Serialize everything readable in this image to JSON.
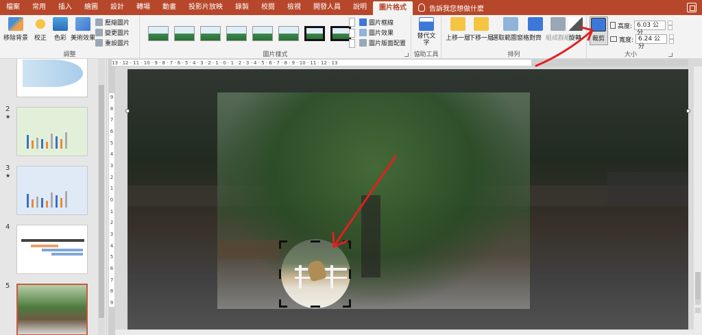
{
  "tabs": [
    {
      "label": "檔案",
      "active": false
    },
    {
      "label": "常用",
      "active": false
    },
    {
      "label": "插入",
      "active": false
    },
    {
      "label": "繪圖",
      "active": false
    },
    {
      "label": "設計",
      "active": false
    },
    {
      "label": "轉場",
      "active": false
    },
    {
      "label": "動畫",
      "active": false
    },
    {
      "label": "投影片放映",
      "active": false
    },
    {
      "label": "錄製",
      "active": false
    },
    {
      "label": "校閱",
      "active": false
    },
    {
      "label": "檢視",
      "active": false
    },
    {
      "label": "開發人員",
      "active": false
    },
    {
      "label": "說明",
      "active": false
    },
    {
      "label": "圖片格式",
      "active": true
    }
  ],
  "tell_me": "告訴我您想做什麼",
  "ribbon": {
    "adjust": {
      "label": "調整",
      "remove_bg": "移除背景",
      "corrections": "校正",
      "color": "色彩",
      "artistic": "美術效果",
      "compress": "壓縮圖片",
      "change": "變更圖片",
      "reset": "重設圖片"
    },
    "styles": {
      "label": "圖片樣式",
      "border": "圖片框線",
      "effects": "圖片效果",
      "layout": "圖片版面配置"
    },
    "accessibility": {
      "label": "協助工具",
      "alt_text": "替代文字"
    },
    "arrange": {
      "label": "排列",
      "bring_forward": "上移一層",
      "send_backward": "下移一層",
      "selection_pane": "選取範圍窗格",
      "align": "對齊",
      "group": "組成群組",
      "rotate": "旋轉"
    },
    "size": {
      "label": "大小",
      "crop": "裁剪",
      "height_label": "高度:",
      "height_value": "6.03 公分",
      "width_label": "寬度:",
      "width_value": "6.24 公分"
    }
  },
  "slides": [
    {
      "number": "",
      "starred": false
    },
    {
      "number": "2",
      "starred": true
    },
    {
      "number": "3",
      "starred": true
    },
    {
      "number": "4",
      "starred": false
    },
    {
      "number": "5",
      "starred": false,
      "selected": true
    }
  ],
  "ruler": {
    "horizontal": "13 · 12 · 11 · 10 · 9 · 8 · 7 · 6 · 5 · 4 · 3 · 2 · 1 · 0 · 1 · 2 · 3 · 4 · 5 · 6 · 7 · 8 · 9 · 10 · 11 · 12 · 13",
    "vertical": [
      "9",
      "8",
      "7",
      "6",
      "5",
      "4",
      "3",
      "2",
      "1",
      "0",
      "1",
      "2",
      "3",
      "4",
      "5",
      "6",
      "7",
      "8",
      "9"
    ]
  },
  "colors": {
    "accent": "#b7472a",
    "annotation": "#e02020"
  }
}
